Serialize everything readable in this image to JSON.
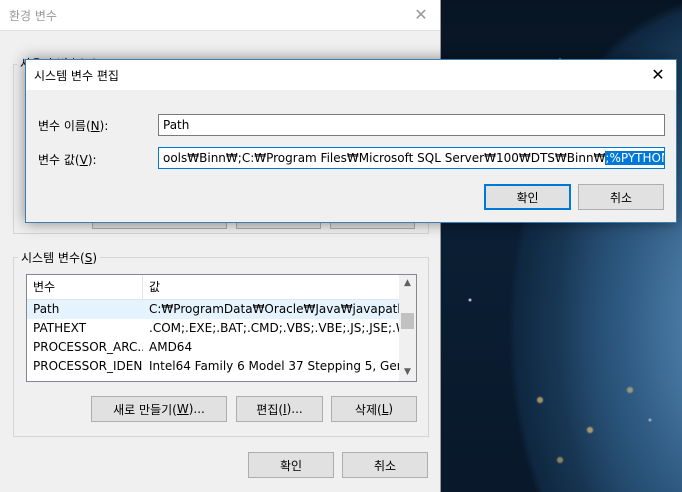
{
  "env_window": {
    "title": "환경 변수",
    "user_group_legend": "사용자 변수(U)",
    "system_group_legend_pre": "시스템 변수(",
    "system_group_legend_key": "S",
    "system_group_legend_post": ")",
    "system_vars": {
      "columns": [
        "변수",
        "값"
      ],
      "rows": [
        {
          "name": "Path",
          "value": "C:₩ProgramData₩Oracle₩Java₩javapath;C:..."
        },
        {
          "name": "PATHEXT",
          "value": ".COM;.EXE;.BAT;.CMD;.VBS;.VBE;.JS;.JSE;.W..."
        },
        {
          "name": "PROCESSOR_ARC...",
          "value": "AMD64"
        },
        {
          "name": "PROCESSOR_IDEN...",
          "value": "Intel64 Family 6 Model 37 Stepping 5, Gen..."
        }
      ]
    },
    "buttons": {
      "new_pre": "새로 만들기(",
      "new_key": "W",
      "new_post": ")...",
      "edit_pre": "편집(",
      "edit_key": "I",
      "edit_post": ")...",
      "delete_pre": "삭제(",
      "delete_key": "L",
      "delete_post": ")",
      "ok": "확인",
      "cancel": "취소"
    }
  },
  "edit_dialog": {
    "title": "시스템 변수 편집",
    "name_label_pre": "변수 이름(",
    "name_label_key": "N",
    "name_label_post": "):",
    "value_label_pre": "변수 값(",
    "value_label_key": "V",
    "value_label_post": "):",
    "name_value": "Path",
    "value_text_normal": "ools₩Binn₩;C:₩Program Files₩Microsoft SQL Server₩100₩DTS₩Binn₩",
    "value_text_selected": ";%PYTHON_HOME%;",
    "ok": "확인",
    "cancel": "취소"
  },
  "colors": {
    "accent": "#0078d7",
    "selection_row": "#e5f3ff"
  }
}
